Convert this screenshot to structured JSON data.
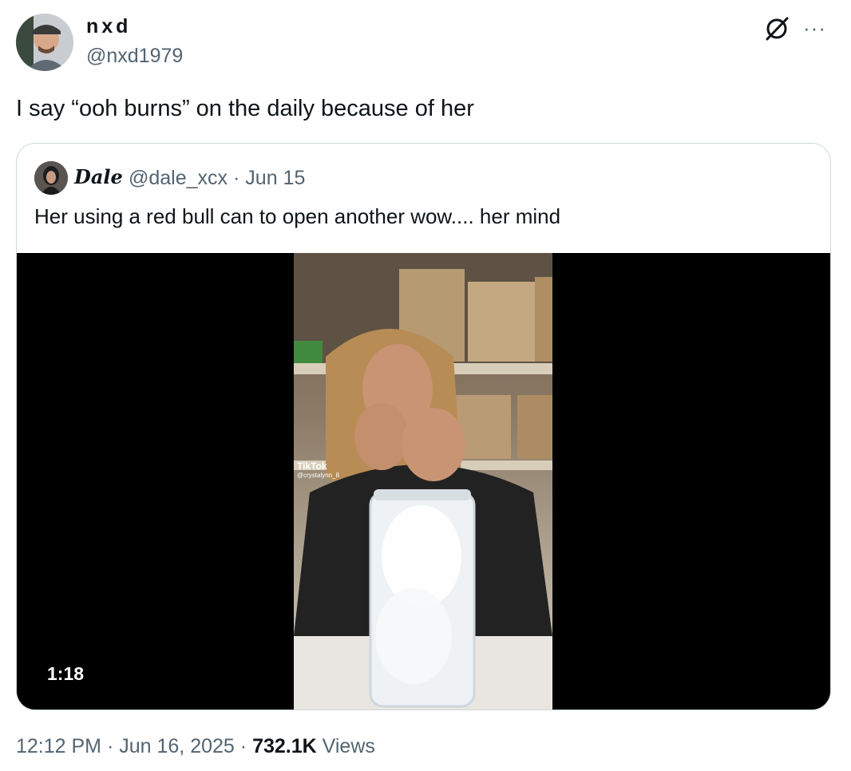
{
  "author": {
    "display_name": "nxd",
    "handle": "@nxd1979"
  },
  "tweet": {
    "text": "I say “ooh burns” on the daily because of her"
  },
  "quoted": {
    "display_name": "Dale",
    "handle": "@dale_xcx",
    "separator": "·",
    "date": "Jun 15",
    "text": "Her using a red bull can to open another wow.... her mind",
    "video": {
      "duration": "1:18",
      "watermark_brand": "TikTok",
      "watermark_user": "@crystalynn_8"
    }
  },
  "footer": {
    "time": "12:12 PM",
    "date": "Jun 16, 2025",
    "separator": "·",
    "views_count": "732.1K",
    "views_label": "Views"
  },
  "icons": {
    "grok": "grok-icon",
    "more": "more-icon"
  },
  "colors": {
    "text_primary": "#0f1419",
    "text_secondary": "#536471",
    "border": "#cfd9de"
  }
}
